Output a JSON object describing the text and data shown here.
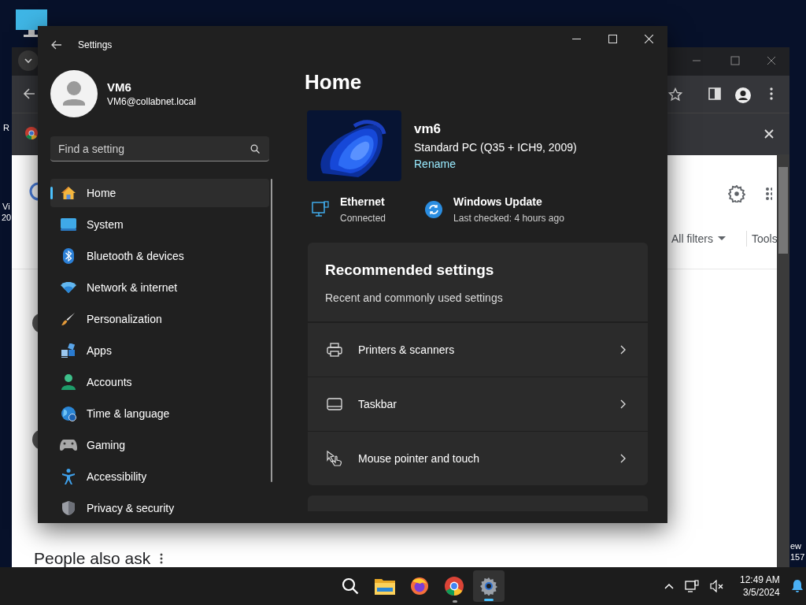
{
  "desktop": {
    "fragments": [
      {
        "text": "R"
      },
      {
        "text": "Vi"
      },
      {
        "text": "20"
      },
      {
        "text": "ew"
      },
      {
        "text": "157"
      }
    ]
  },
  "browser": {
    "filters": [
      {
        "label": "All filters"
      },
      {
        "label": "Tools"
      }
    ],
    "section_title": "People also ask"
  },
  "settings": {
    "title": "Settings",
    "user": {
      "name": "VM6",
      "email": "VM6@collabnet.local"
    },
    "search": {
      "placeholder": "Find a setting"
    },
    "nav": [
      {
        "label": "Home",
        "selected": true
      },
      {
        "label": "System",
        "selected": false
      },
      {
        "label": "Bluetooth & devices",
        "selected": false
      },
      {
        "label": "Network & internet",
        "selected": false
      },
      {
        "label": "Personalization",
        "selected": false
      },
      {
        "label": "Apps",
        "selected": false
      },
      {
        "label": "Accounts",
        "selected": false
      },
      {
        "label": "Time & language",
        "selected": false
      },
      {
        "label": "Gaming",
        "selected": false
      },
      {
        "label": "Accessibility",
        "selected": false
      },
      {
        "label": "Privacy & security",
        "selected": false
      }
    ],
    "page_title": "Home",
    "device": {
      "name": "vm6",
      "model": "Standard PC (Q35 + ICH9, 2009)",
      "rename": "Rename"
    },
    "status": [
      {
        "title": "Ethernet",
        "detail": "Connected"
      },
      {
        "title": "Windows Update",
        "detail": "Last checked: 4 hours ago"
      }
    ],
    "recommended": {
      "title": "Recommended settings",
      "subtitle": "Recent and commonly used settings",
      "items": [
        {
          "label": "Printers & scanners"
        },
        {
          "label": "Taskbar"
        },
        {
          "label": "Mouse pointer and touch"
        }
      ]
    }
  },
  "taskbar": {
    "apps": [
      {
        "active": false
      },
      {
        "active": false
      },
      {
        "active": false
      },
      {
        "active": false
      },
      {
        "active": true
      }
    ],
    "time": "12:49 AM",
    "date": "3/5/2024"
  }
}
